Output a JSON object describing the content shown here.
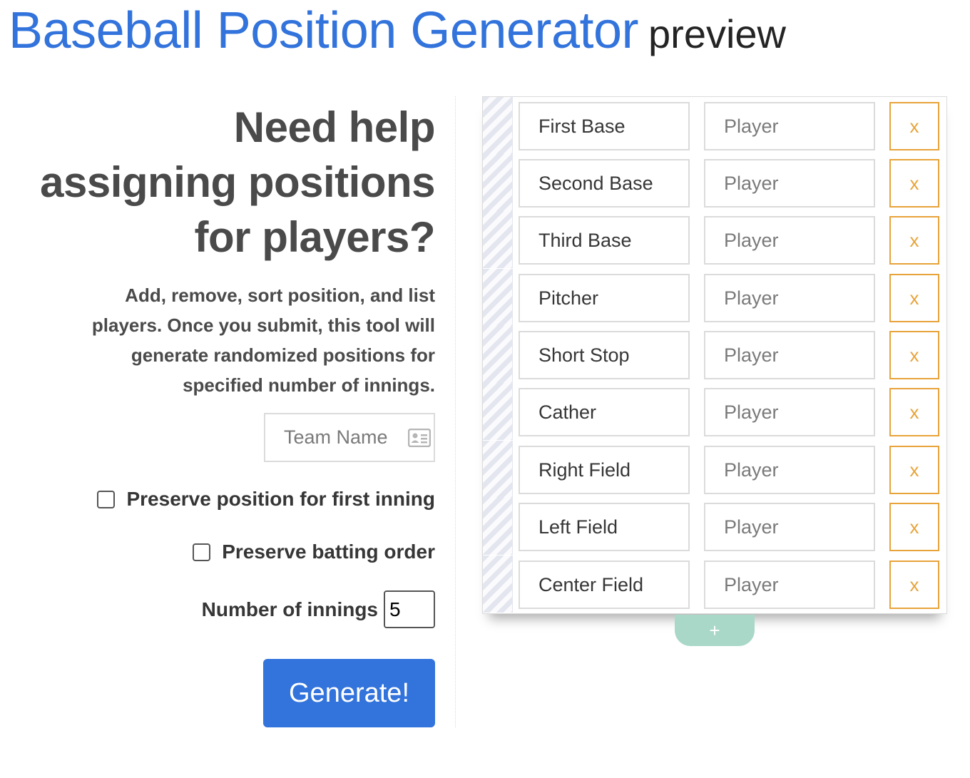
{
  "header": {
    "title": "Baseball Position Generator",
    "subtitle": "preview"
  },
  "intro": {
    "headline_lines": [
      "Need help",
      "assigning positions",
      "for players?"
    ],
    "description_lines": [
      "Add, remove, sort position, and list",
      "players. Once you submit, this tool will",
      "generate randomized positions for",
      "specified number of innings."
    ]
  },
  "form": {
    "team_name_placeholder": "Team Name",
    "team_name_icon": "id-card-icon",
    "preserve_first_inning_label": "Preserve position for first inning",
    "preserve_first_inning_checked": false,
    "preserve_batting_order_label": "Preserve batting order",
    "preserve_batting_order_checked": false,
    "innings_label": "Number of innings",
    "innings_value": "5",
    "generate_label": "Generate!"
  },
  "positions": {
    "player_placeholder": "Player",
    "delete_label": "x",
    "add_label": "+",
    "rows": [
      {
        "position": "First Base"
      },
      {
        "position": "Second Base"
      },
      {
        "position": "Third Base"
      },
      {
        "position": "Pitcher"
      },
      {
        "position": "Short Stop"
      },
      {
        "position": "Cather"
      },
      {
        "position": "Right Field"
      },
      {
        "position": "Left Field"
      },
      {
        "position": "Center Field"
      }
    ]
  },
  "colors": {
    "primary": "#3273dc",
    "warning": "#e8a33a",
    "add_button": "#a9d8c9"
  }
}
